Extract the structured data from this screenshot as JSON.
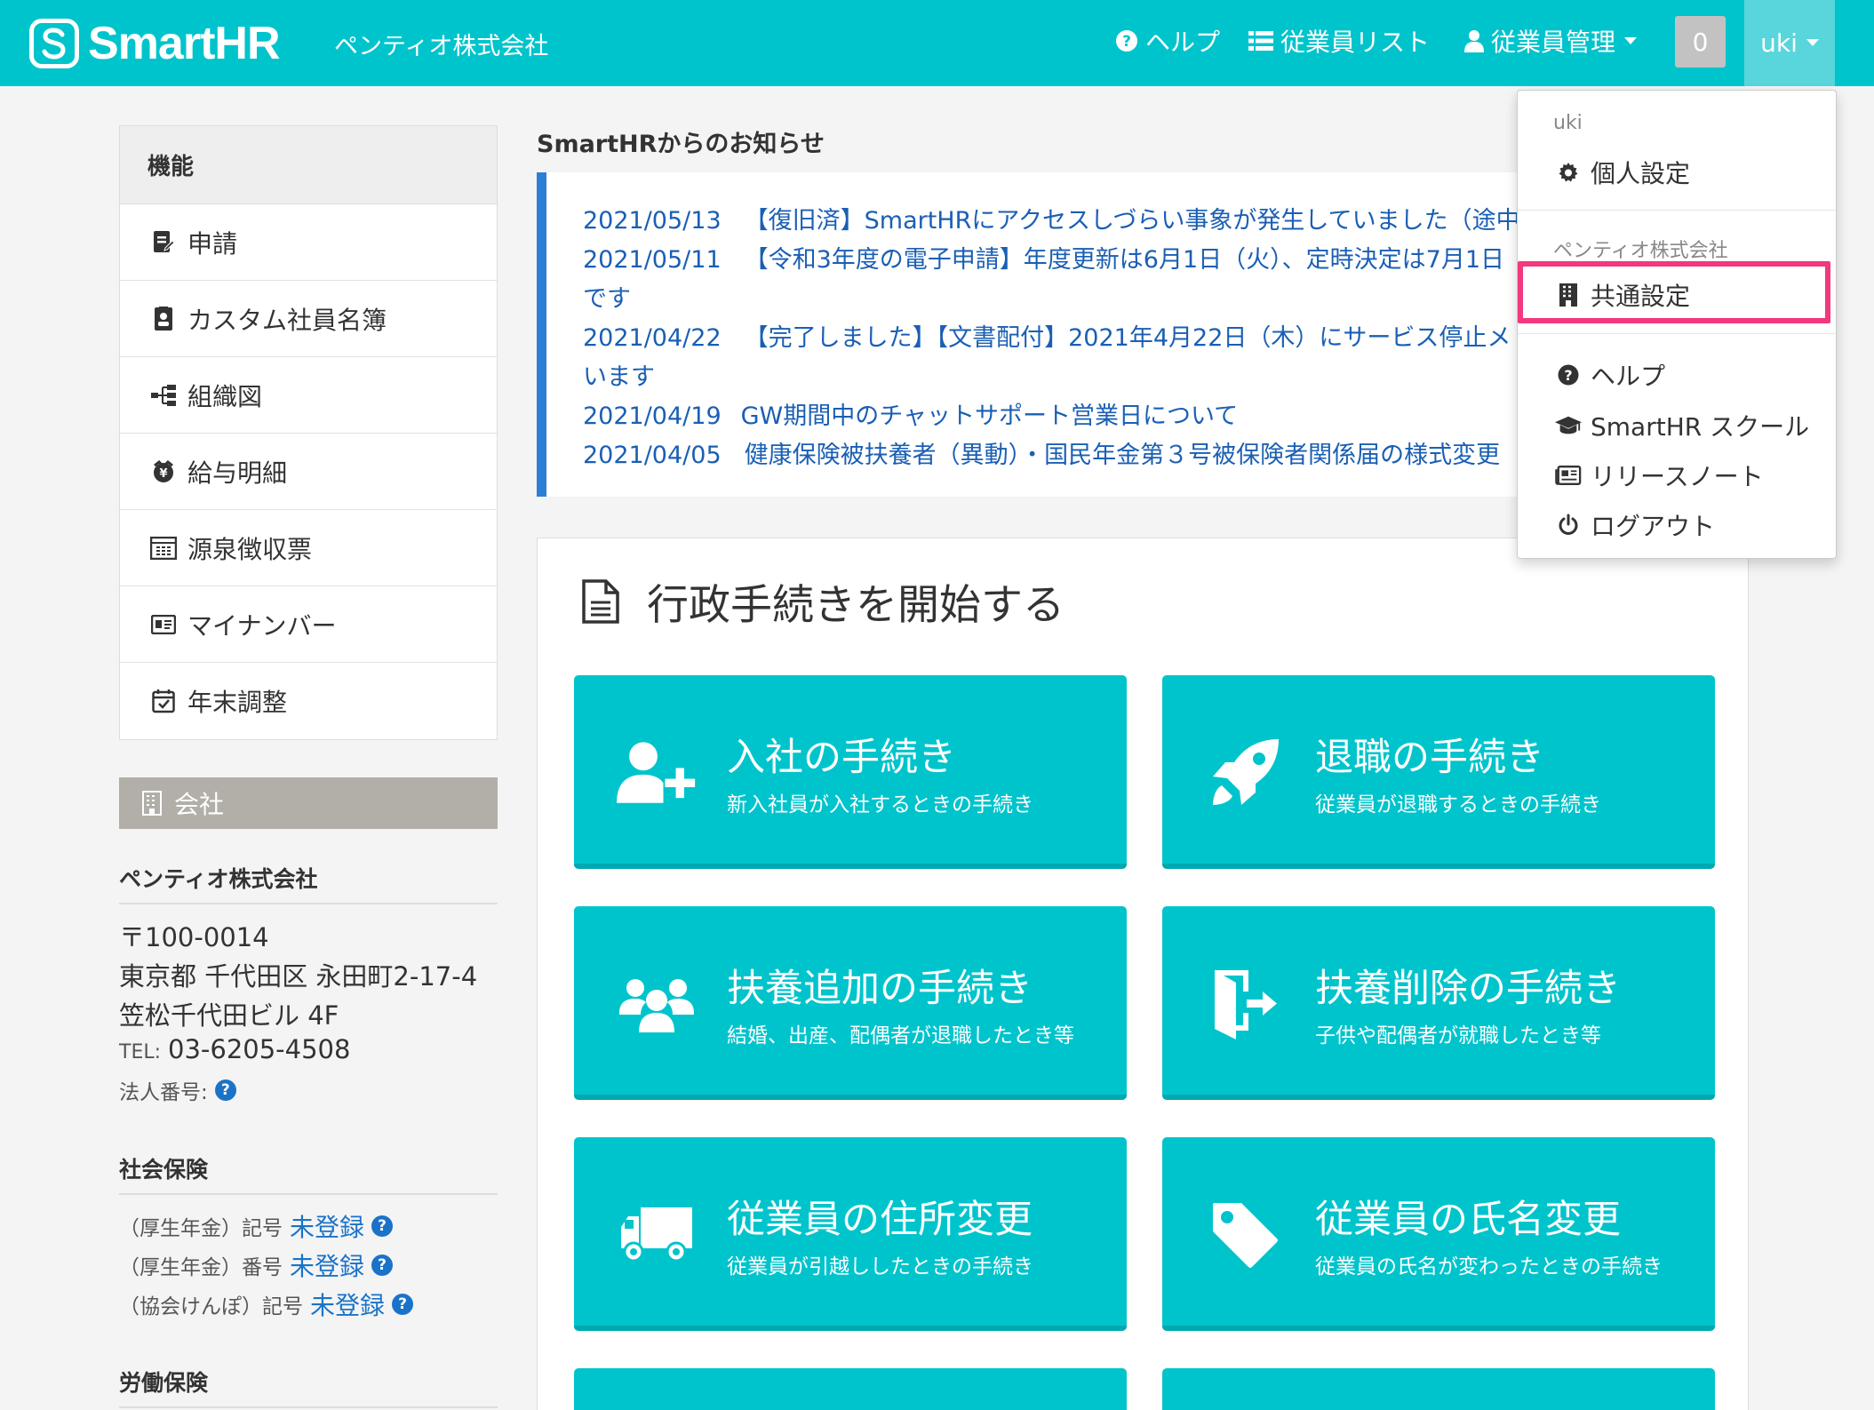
{
  "header": {
    "logo_text": "SmartHR",
    "company": "ペンティオ株式会社",
    "nav": {
      "help": "ヘルプ",
      "employee_list": "従業員リスト",
      "employee_manage": "従業員管理"
    },
    "badge_count": "0",
    "user": "uki"
  },
  "sidebar": {
    "title": "機能",
    "items": [
      {
        "label": "申請",
        "icon": "application-icon"
      },
      {
        "label": "カスタム社員名簿",
        "icon": "roster-icon"
      },
      {
        "label": "組織図",
        "icon": "org-chart-icon"
      },
      {
        "label": "給与明細",
        "icon": "payslip-icon"
      },
      {
        "label": "源泉徴収票",
        "icon": "withholding-icon"
      },
      {
        "label": "マイナンバー",
        "icon": "mynumber-icon"
      },
      {
        "label": "年末調整",
        "icon": "calendar-icon"
      }
    ],
    "company_section": "会社",
    "company_name": "ペンティオ株式会社",
    "postal": "〒100-0014",
    "address1": "東京都 千代田区 永田町2-17-4",
    "address2": "笠松千代田ビル 4F",
    "tel_label": "TEL:",
    "tel": "03-6205-4508",
    "corp_number_label": "法人番号:",
    "social_insurance": {
      "title": "社会保険",
      "rows": [
        {
          "label": "（厚生年金）記号",
          "value": "未登録"
        },
        {
          "label": "（厚生年金）番号",
          "value": "未登録"
        },
        {
          "label": "（協会けんぽ）記号",
          "value": "未登録"
        }
      ]
    },
    "labor_insurance_title": "労働保険"
  },
  "news": {
    "title": "SmartHRからのお知らせ",
    "items": [
      {
        "date": "2021/05/13",
        "title": "【復旧済】SmartHRにアクセスしづらい事象が発生していました（途中"
      },
      {
        "date": "2021/05/11",
        "title": "【令和3年度の電子申請】年度更新は6月1日（火）、定時決定は7月1日",
        "cont": "です"
      },
      {
        "date": "2021/04/22",
        "title": "【完了しました】【文書配付】2021年4月22日（木）にサービス停止メ",
        "cont": "います"
      },
      {
        "date": "2021/04/19",
        "title": "GW期間中のチャットサポート営業日について"
      },
      {
        "date": "2021/04/05",
        "title": "健康保険被扶養者（異動）・国民年金第３号被保険者関係届の様式変更"
      }
    ]
  },
  "procedures": {
    "title": "行政手続きを開始する",
    "tiles": [
      {
        "title": "入社の手続き",
        "sub": "新入社員が入社するときの手続き",
        "icon": "user-plus-icon"
      },
      {
        "title": "退職の手続き",
        "sub": "従業員が退職するときの手続き",
        "icon": "rocket-icon"
      },
      {
        "title": "扶養追加の手続き",
        "sub": "結婚、出産、配偶者が退職したとき等",
        "icon": "users-icon"
      },
      {
        "title": "扶養削除の手続き",
        "sub": "子供や配偶者が就職したとき等",
        "icon": "exit-door-icon"
      },
      {
        "title": "従業員の住所変更",
        "sub": "従業員が引越ししたときの手続き",
        "icon": "truck-icon"
      },
      {
        "title": "従業員の氏名変更",
        "sub": "従業員の氏名が変わったときの手続き",
        "icon": "tag-icon"
      }
    ]
  },
  "dropdown": {
    "user_label": "uki",
    "personal_settings": "個人設定",
    "company_label": "ペンティオ株式会社",
    "common_settings": "共通設定",
    "help": "ヘルプ",
    "school": "SmartHR スクール",
    "release_notes": "リリースノート",
    "logout": "ログアウト"
  },
  "colors": {
    "brand": "#00c4cc",
    "link": "#1a73c8",
    "highlight": "#f2387f",
    "news_accent": "#2b7fd4"
  }
}
